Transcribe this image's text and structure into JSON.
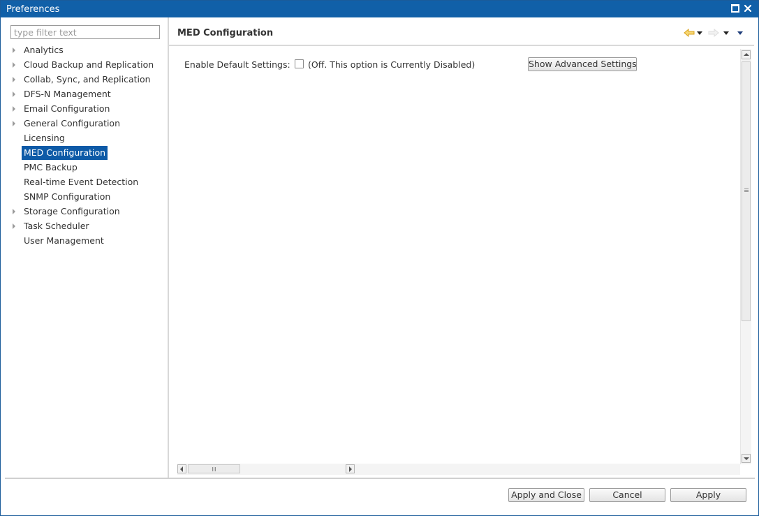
{
  "window": {
    "title": "Preferences",
    "accent_color": "#1160a8",
    "controls": [
      "maximize-icon",
      "close-icon"
    ]
  },
  "sidebar": {
    "filter_placeholder": "type filter text",
    "selection_color": "#0d5aa7",
    "items": [
      {
        "label": "Analytics",
        "expandable": true,
        "selected": false
      },
      {
        "label": "Cloud Backup and Replication",
        "expandable": true,
        "selected": false
      },
      {
        "label": "Collab, Sync, and Replication",
        "expandable": true,
        "selected": false
      },
      {
        "label": "DFS-N Management",
        "expandable": true,
        "selected": false
      },
      {
        "label": "Email Configuration",
        "expandable": true,
        "selected": false
      },
      {
        "label": "General Configuration",
        "expandable": true,
        "selected": false
      },
      {
        "label": "Licensing",
        "expandable": false,
        "selected": false
      },
      {
        "label": "MED Configuration",
        "expandable": false,
        "selected": true
      },
      {
        "label": "PMC Backup",
        "expandable": false,
        "selected": false
      },
      {
        "label": "Real-time Event Detection",
        "expandable": false,
        "selected": false
      },
      {
        "label": "SNMP Configuration",
        "expandable": false,
        "selected": false
      },
      {
        "label": "Storage Configuration",
        "expandable": true,
        "selected": false
      },
      {
        "label": "Task Scheduler",
        "expandable": true,
        "selected": false
      },
      {
        "label": "User Management",
        "expandable": false,
        "selected": false
      }
    ]
  },
  "page": {
    "title": "MED Configuration",
    "nav_icons": [
      "back-arrow-icon",
      "back-dropdown-icon",
      "forward-arrow-icon",
      "forward-dropdown-icon",
      "view-menu-icon"
    ],
    "enable_default_label": "Enable Default Settings:",
    "enable_default_checked": false,
    "enable_default_status": "(Off. This option is Currently Disabled)",
    "advanced_button": "Show Advanced Settings"
  },
  "footer": {
    "apply_close": "Apply and Close",
    "cancel": "Cancel",
    "apply": "Apply"
  }
}
